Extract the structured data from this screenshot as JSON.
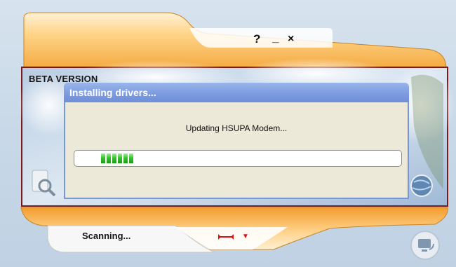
{
  "window": {
    "controls": {
      "help": "?",
      "minimize": "_",
      "close": "×"
    },
    "beta_label": "BETA VERSION"
  },
  "dialog": {
    "title": "Installing drivers...",
    "message": "Updating HSUPA Modem...",
    "progress": {
      "value": 0.15,
      "segments_lit": 6
    }
  },
  "footer": {
    "status": "Scanning...",
    "icons": [
      "wrench-icon",
      "dropdown-arrow-icon",
      "magnifier-device-icon",
      "globe-icon",
      "computer-network-icon"
    ]
  },
  "colors": {
    "accent_orange": "#f3a63b",
    "title_blue": "#7c9be0",
    "progress_green": "#38c32e",
    "frame_red": "#7a1b1b"
  }
}
